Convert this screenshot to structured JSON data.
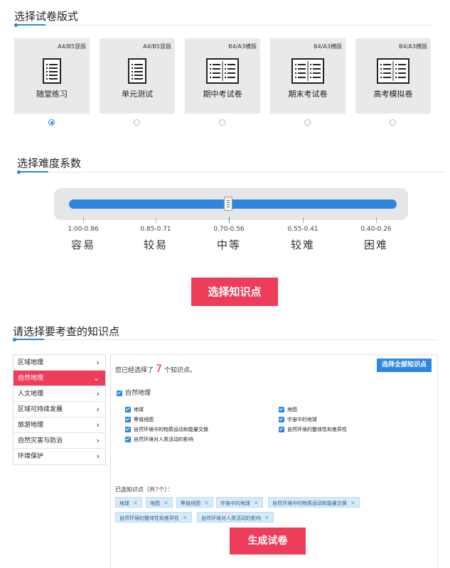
{
  "sections": {
    "layout_title": "选择试卷版式",
    "difficulty_title": "选择难度系数",
    "knowledge_title": "请选择要考查的知识点"
  },
  "templates": [
    {
      "size": "A4/B5竖版",
      "name": "随堂练习",
      "icon": "portrait-document-icon",
      "selected": true
    },
    {
      "size": "A4/B5竖版",
      "name": "单元测试",
      "icon": "portrait-document-icon",
      "selected": false
    },
    {
      "size": "B4/A3横版",
      "name": "期中考试卷",
      "icon": "landscape-document-icon",
      "selected": false
    },
    {
      "size": "B4/A3横版",
      "name": "期末考试卷",
      "icon": "landscape-document-icon",
      "selected": false
    },
    {
      "size": "B4/A3横版",
      "name": "高考模拟卷",
      "icon": "landscape-document-icon",
      "selected": false
    }
  ],
  "difficulty": {
    "selected_index": 2,
    "levels": [
      {
        "range": "1.00-0.86",
        "label": "容易"
      },
      {
        "range": "0.85-0.71",
        "label": "较易"
      },
      {
        "range": "0.70-0.56",
        "label": "中等"
      },
      {
        "range": "0.55-0.41",
        "label": "较难"
      },
      {
        "range": "0.40-0.26",
        "label": "困难"
      }
    ]
  },
  "select_knowledge_button": "选择知识点",
  "categories": [
    {
      "label": "区域地理",
      "active": false
    },
    {
      "label": "自然地理",
      "active": true
    },
    {
      "label": "人文地理",
      "active": false
    },
    {
      "label": "区域可持续发展",
      "active": false
    },
    {
      "label": "旅游地理",
      "active": false
    },
    {
      "label": "自然灾害与防治",
      "active": false
    },
    {
      "label": "环境保护",
      "active": false
    }
  ],
  "knowledge": {
    "summary_prefix": "您已经选择了",
    "count": "7",
    "summary_suffix": "个知识点。",
    "select_all_button": "选择全部知识点",
    "group_label": "自然地理",
    "items": [
      {
        "label": "地球",
        "checked": true
      },
      {
        "label": "地图",
        "checked": true
      },
      {
        "label": "等值线图",
        "checked": true
      },
      {
        "label": "宇宙中的地球",
        "checked": true
      },
      {
        "label": "自然环境中的物质运动和能量交换",
        "checked": true
      },
      {
        "label": "自然环境的整体性和差异性",
        "checked": true
      },
      {
        "label": "自然环境对人类活动的影响",
        "checked": true
      }
    ],
    "selected_prefix": "已选知识点（共",
    "selected_count": "7",
    "selected_suffix": "个）：",
    "tags": [
      "地球",
      "地图",
      "等值线图",
      "宇宙中的地球",
      "自然环境中的物质运动和能量交换",
      "自然环境的整体性和差异性",
      "自然环境对人类活动的影响"
    ]
  },
  "generate_button": "生成试卷",
  "colors": {
    "accent": "#2e86de",
    "primary_red": "#ee3d5a"
  }
}
